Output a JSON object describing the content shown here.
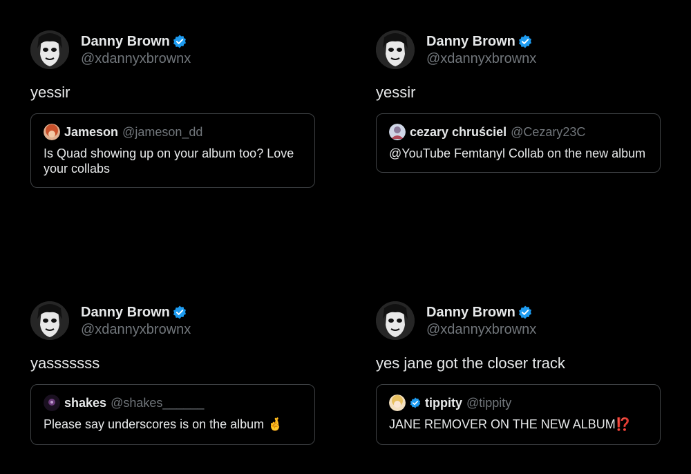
{
  "tweets": [
    {
      "author_name": "Danny Brown",
      "author_handle": "@xdannyxbrownx",
      "text": "yessir",
      "quote": {
        "name": "Jameson",
        "handle": "@jameson_dd",
        "text": " Is Quad showing up on your album too? Love your collabs"
      }
    },
    {
      "author_name": "Danny Brown",
      "author_handle": "@xdannyxbrownx",
      "text": "yessir",
      "quote": {
        "name": "cezary chruściel",
        "handle": "@Cezary23C",
        "text": " @YouTube Femtanyl Collab on the new album"
      }
    },
    {
      "author_name": "Danny Brown",
      "author_handle": "@xdannyxbrownx",
      "text": "yasssssss",
      "quote": {
        "name": "shakes",
        "handle": "@shakes______",
        "text": " Please say underscores is on the album 🤞"
      }
    },
    {
      "author_name": "Danny Brown",
      "author_handle": "@xdannyxbrownx",
      "text": "yes jane got the closer track",
      "quote": {
        "name": "tippity",
        "handle": "@tippity",
        "text": " JANE REMOVER ON THE NEW ALBUM⁉️"
      }
    }
  ],
  "colors": {
    "verified": "#1d9bf0",
    "muted": "#71767b",
    "border": "#3e4144",
    "text": "#e7e9ea"
  }
}
